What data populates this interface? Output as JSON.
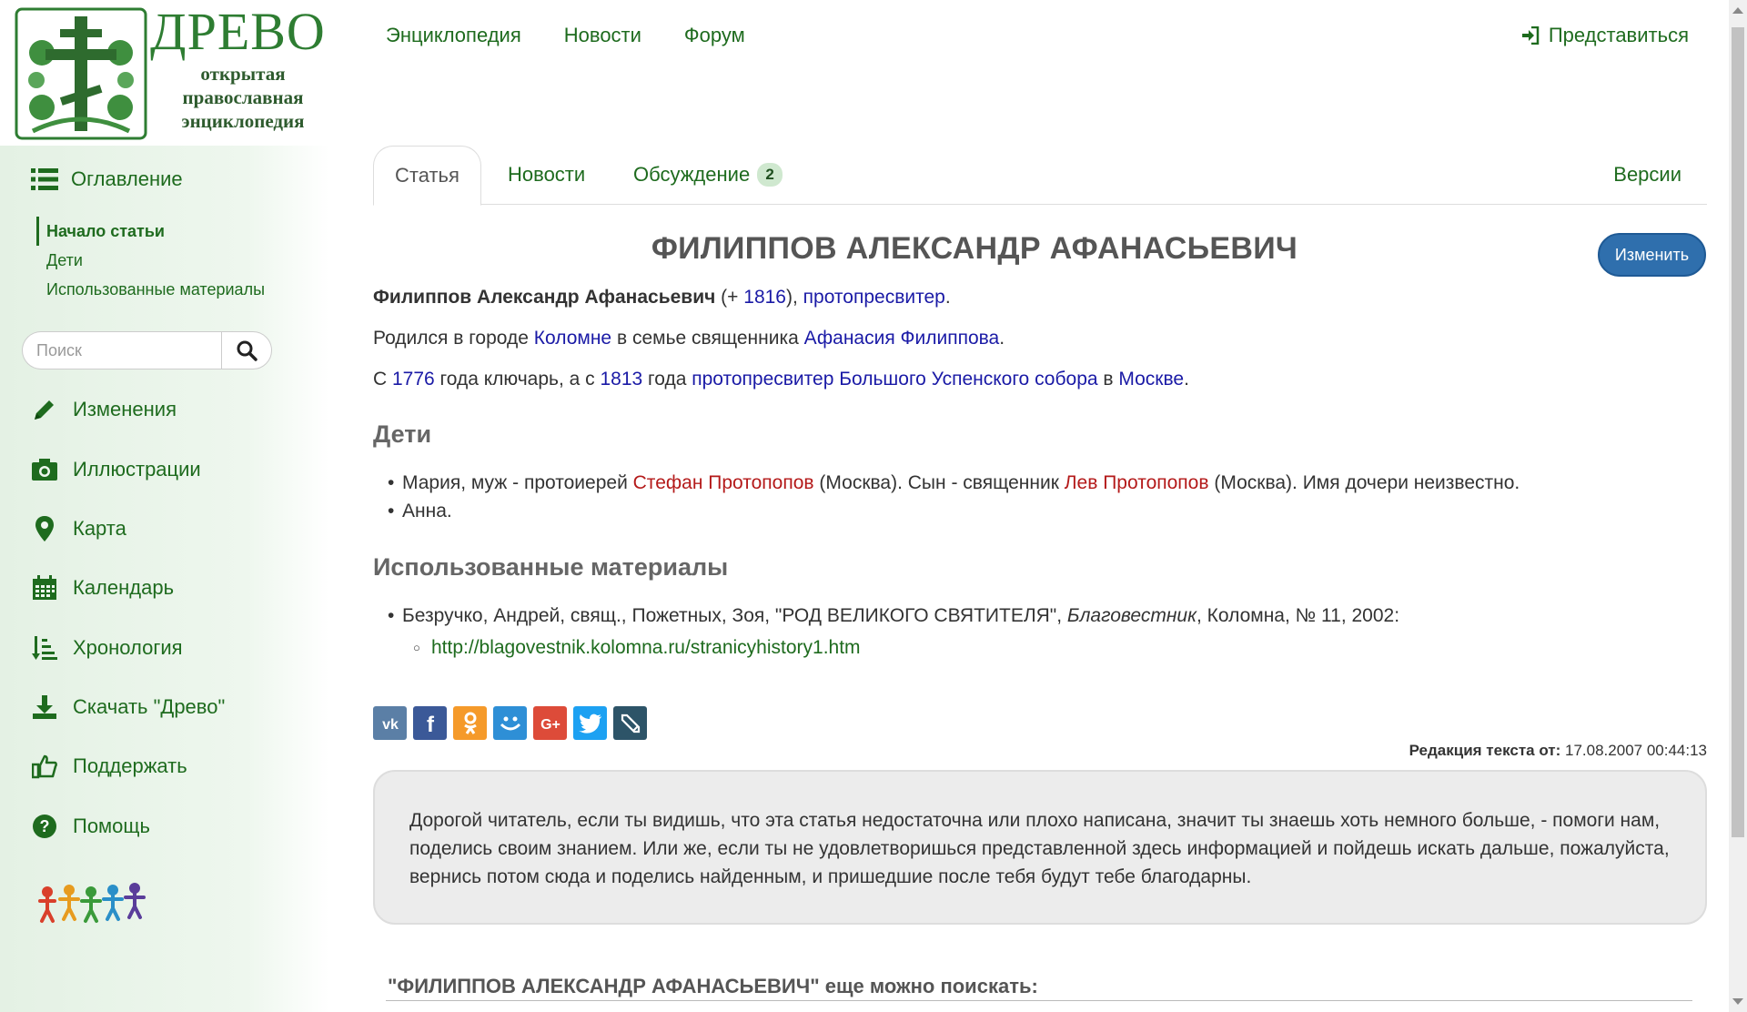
{
  "logo": {
    "title": "ДРЕВО",
    "subtitle": "открытая православная энциклопедия"
  },
  "topnav": {
    "items": [
      "Энциклопедия",
      "Новости",
      "Форум"
    ],
    "login": "Представиться"
  },
  "sidebar": {
    "toc_label": "Оглавление",
    "toc_items": [
      "Начало статьи",
      "Дети",
      "Использованные материалы"
    ],
    "search_placeholder": "Поиск",
    "nav": [
      {
        "label": "Изменения",
        "icon": "pencil-icon"
      },
      {
        "label": "Иллюстрации",
        "icon": "camera-icon"
      },
      {
        "label": "Карта",
        "icon": "map-marker-icon"
      },
      {
        "label": "Календарь",
        "icon": "calendar-icon"
      },
      {
        "label": "Хронология",
        "icon": "sort-order-icon"
      },
      {
        "label": "Скачать \"Древо\"",
        "icon": "download-icon"
      },
      {
        "label": "Поддержать",
        "icon": "thumbs-up-icon"
      },
      {
        "label": "Помощь",
        "icon": "question-circle-icon"
      }
    ]
  },
  "tabs": {
    "article": "Статья",
    "news": "Новости",
    "discussion": "Обсуждение",
    "discussion_count": "2",
    "versions": "Версии"
  },
  "article": {
    "edit_button": "Изменить",
    "title": "ФИЛИППОВ АЛЕКСАНДР АФАНАСЬЕВИЧ",
    "p1": {
      "name": "Филиппов Александр Афанасьевич",
      "open": " (+ ",
      "year": "1816",
      "mid": "), ",
      "rank": "протопресвитер",
      "end": "."
    },
    "p2": {
      "t1": "Родился в городе ",
      "city": "Коломне",
      "t2": " в семье священника ",
      "father": "Афанасия Филиппова",
      "t3": "."
    },
    "p3": {
      "t1": "С ",
      "y1": "1776",
      "t2": " года ключарь, а с ",
      "y2": "1813",
      "t3": " года ",
      "office": "протопресвитер Большого Успенского собора",
      "t4": " в ",
      "city": "Москве",
      "t5": "."
    },
    "children_heading": "Дети",
    "child1": {
      "t1": "Мария, муж - протоиерей ",
      "husband": "Стефан Протопопов",
      "t2": " (Москва). Сын - священник ",
      "son": "Лев Протопопов",
      "t3": " (Москва). Имя дочери неизвестно."
    },
    "child2": "Анна.",
    "materials_heading": "Использованные материалы",
    "source": {
      "t1": "Безручко, Андрей, свящ., Пожетных, Зоя, \"РОД ВЕЛИКОГО СВЯТИТЕЛЯ\", ",
      "journal": "Благовестник",
      "t2": ", Коломна, № 11, 2002:",
      "url": "http://blagovestnik.kolomna.ru/stranicyhistory1.htm"
    },
    "edit_date_label": "Редакция текста от:",
    "edit_date": "17.08.2007 00:44:13",
    "notice": "Дорогой читатель, если ты видишь, что эта статья недостаточна или плохо написана, значит ты знаешь хоть немного больше, - помоги нам, поделись своим знанием. Или же, если ты не удовлетворишься представленной здесь информацией и пойдешь искать дальше, пожалуйста, вернись потом сюда и поделись найденным, и пришедшие после тебя будут тебе благодарны.",
    "search_more": "\"ФИЛИППОВ АЛЕКСАНДР АФАНАСЬЕВИЧ\" еще можно поискать:"
  },
  "share": [
    {
      "name": "vk-share-icon",
      "color": "#5b7fa6"
    },
    {
      "name": "facebook-share-icon",
      "color": "#3b5998"
    },
    {
      "name": "odnoklassniki-share-icon",
      "color": "#f59a2a"
    },
    {
      "name": "moimir-share-icon",
      "color": "#2e8fd6"
    },
    {
      "name": "googleplus-share-icon",
      "color": "#dd4b39"
    },
    {
      "name": "twitter-share-icon",
      "color": "#1da1f2"
    },
    {
      "name": "livejournal-share-icon",
      "color": "#2d5468"
    }
  ],
  "colors": {
    "accent_green": "#1e6b1e",
    "link_blue": "#1a1aa6",
    "redlink": "#b41a1a",
    "edit_button": "#2f6fad"
  }
}
